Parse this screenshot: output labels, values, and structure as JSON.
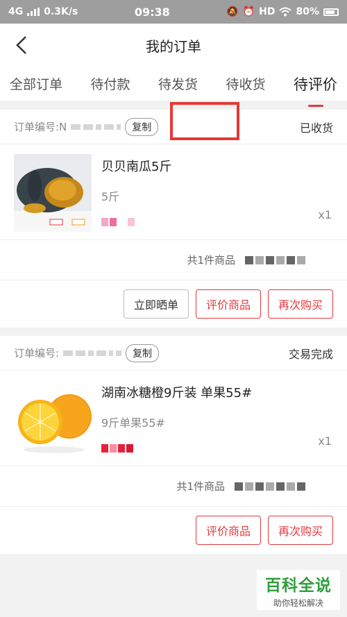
{
  "status_bar": {
    "network": "4G",
    "speed": "0.3K/s",
    "time": "09:38",
    "hd": "HD",
    "battery": "80%"
  },
  "header": {
    "title": "我的订单"
  },
  "tabs": [
    {
      "label": "全部订单",
      "active": false
    },
    {
      "label": "待付款",
      "active": false
    },
    {
      "label": "待发货",
      "active": false
    },
    {
      "label": "待收货",
      "active": false
    },
    {
      "label": "待评价",
      "active": true
    }
  ],
  "orders": [
    {
      "order_no_label": "订单编号:N",
      "copy_label": "复制",
      "status": "已收货",
      "product_name": "贝贝南瓜5斤",
      "product_spec": "5斤",
      "quantity": "x1",
      "summary": "共1件商品",
      "buttons": [
        "立即晒单",
        "评价商品",
        "再次购买"
      ]
    },
    {
      "order_no_label": "订单编号:",
      "copy_label": "复制",
      "status": "交易完成",
      "product_name": "湖南冰糖橙9斤装 单果55#",
      "product_spec": "9斤单果55#",
      "quantity": "x1",
      "summary": "共1件商品",
      "buttons": [
        "评价商品",
        "再次购买"
      ]
    }
  ],
  "watermark": {
    "title": "百科全说",
    "subtitle": "助你轻松解决"
  },
  "colors": {
    "accent": "#e4393c",
    "highlight": "#e53935",
    "watermark_green": "#2e9f3a"
  },
  "icons": {
    "back": "chevron-left-icon",
    "wifi": "wifi-icon",
    "alarm": "alarm-icon",
    "mute": "mute-icon"
  }
}
